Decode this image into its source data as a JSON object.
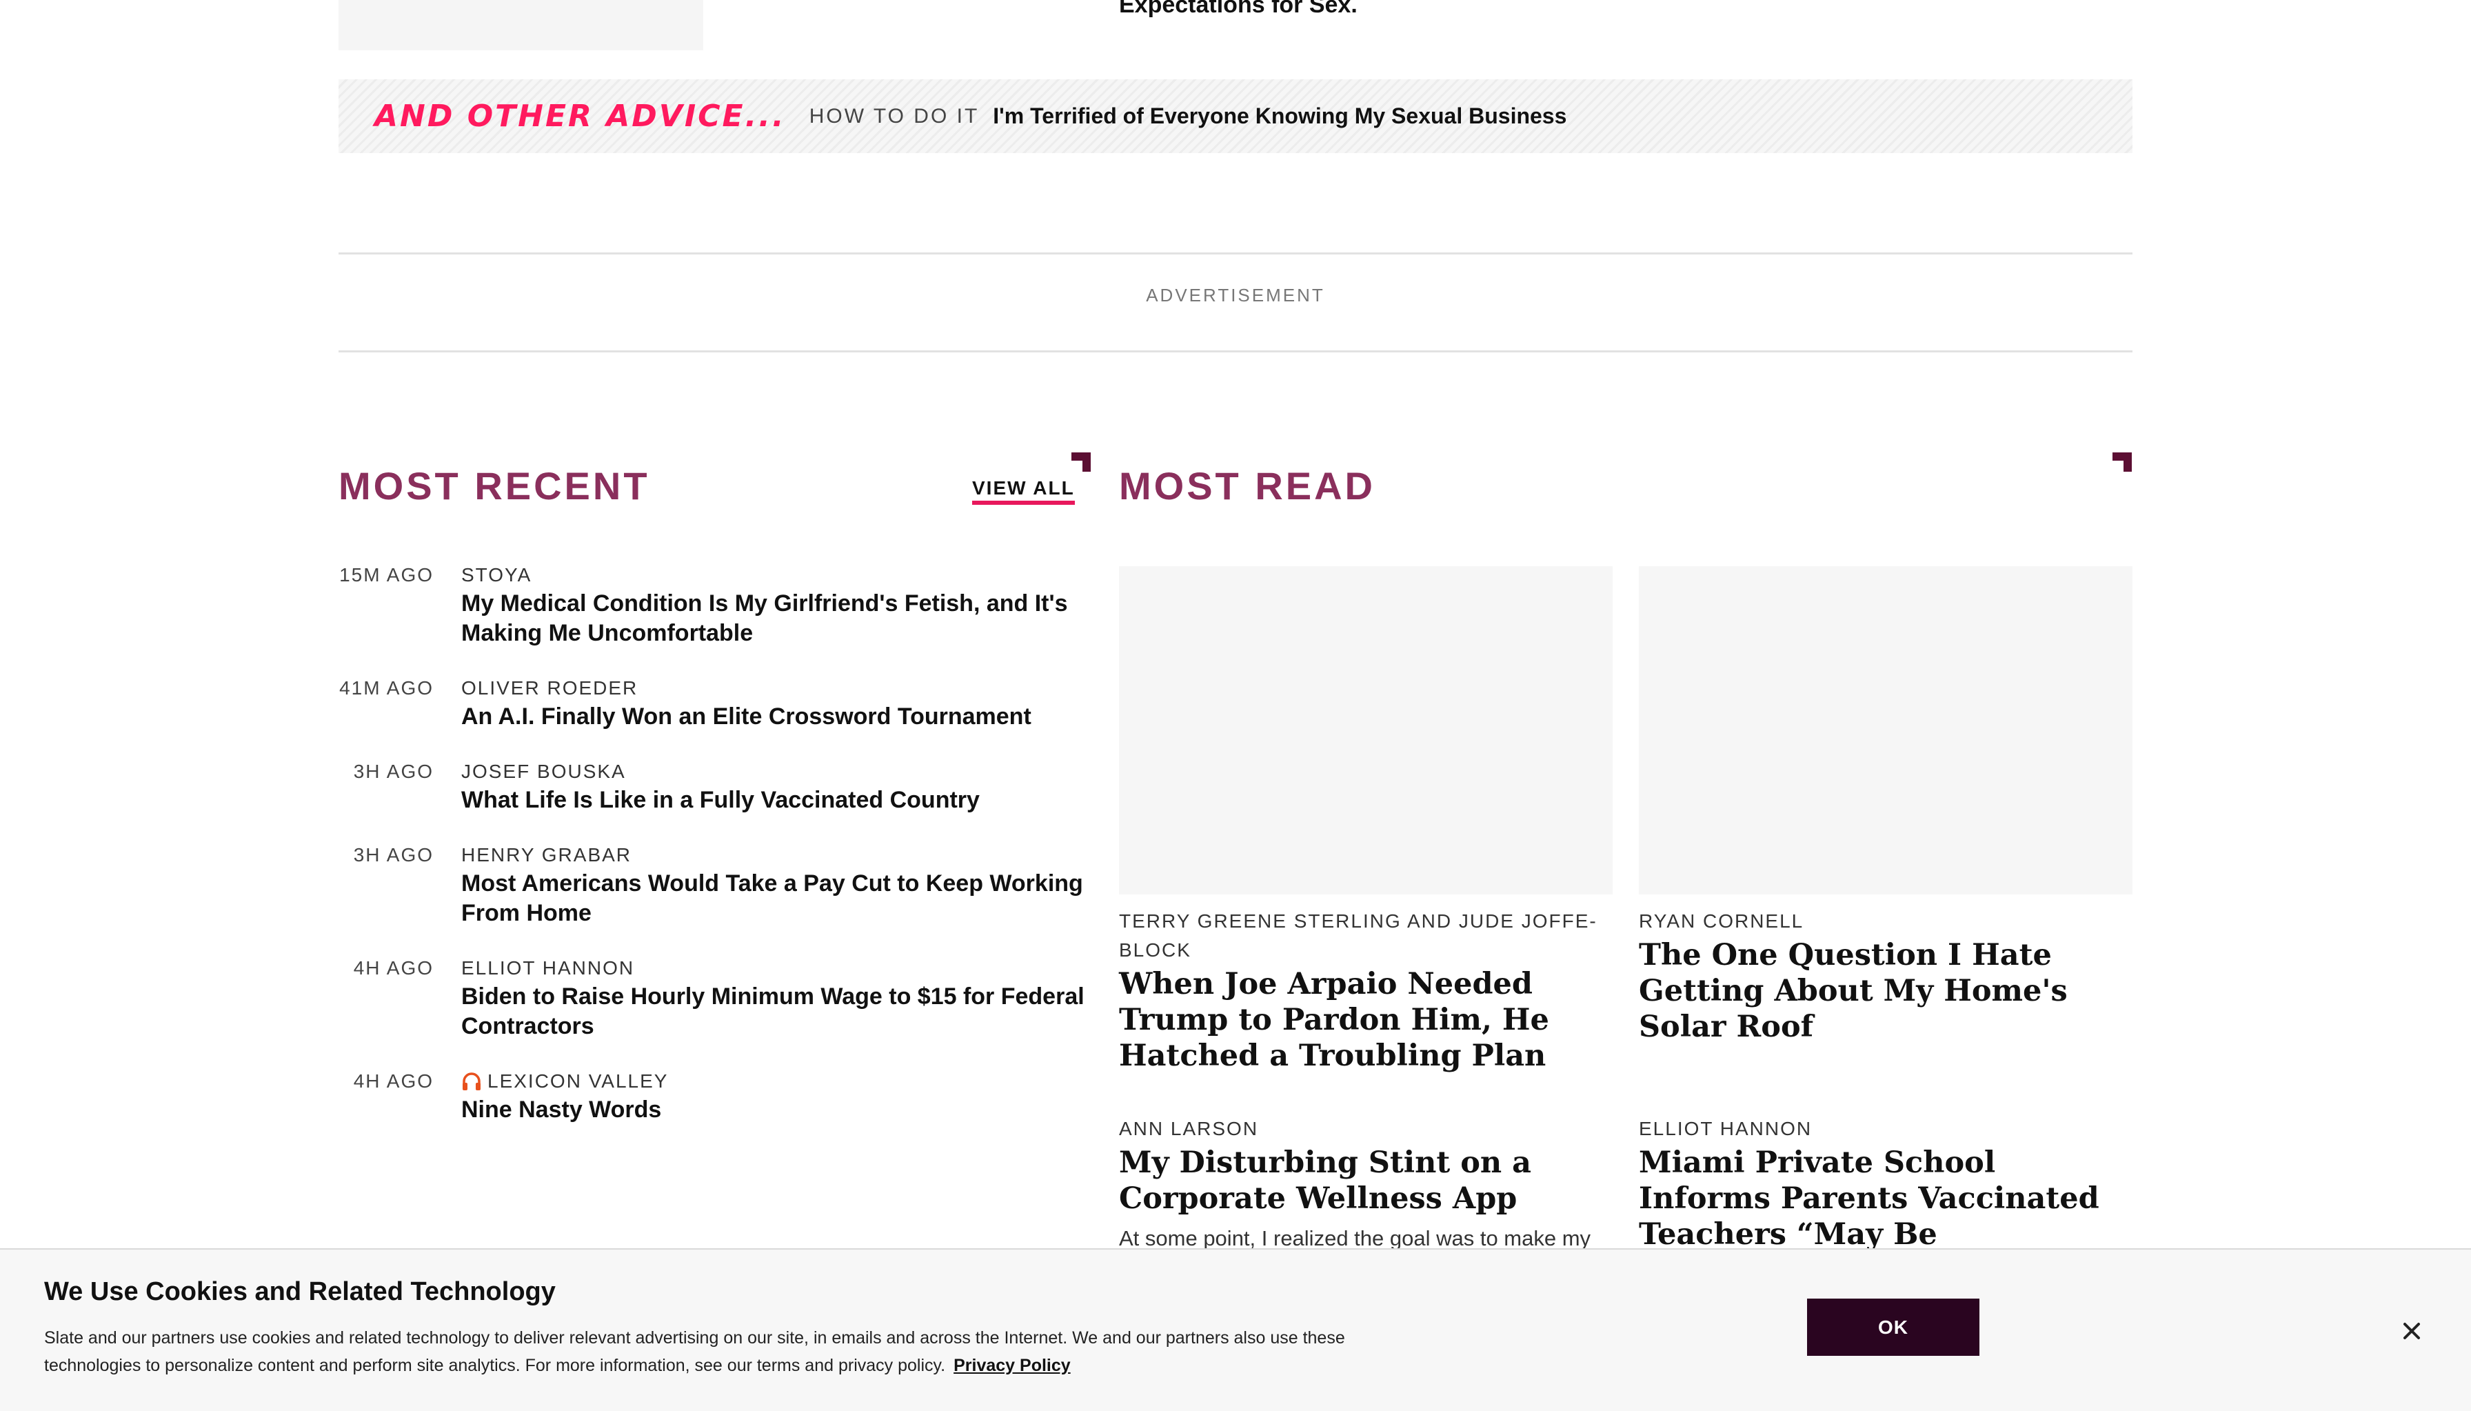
{
  "top": {
    "headline_fragment": "Expectations for Sex."
  },
  "advice_bar": {
    "brand": "AND OTHER ADVICE...",
    "kicker": "HOW TO DO IT",
    "title": "I'm Terrified of Everyone Knowing My Sexual Business"
  },
  "ad": {
    "label": "ADVERTISEMENT"
  },
  "most_recent": {
    "title": "MOST RECENT",
    "view_all": "VIEW ALL",
    "items": [
      {
        "time": "15M AGO",
        "author": "STOYA",
        "title": "My Medical Condition Is My Girlfriend's Fetish, and It's Making Me Uncomfortable"
      },
      {
        "time": "41M AGO",
        "author": "OLIVER ROEDER",
        "title": "An A.I. Finally Won an Elite Crossword Tournament"
      },
      {
        "time": "3H AGO",
        "author": "JOSEF BOUSKA",
        "title": "What Life Is Like in a Fully Vaccinated Country"
      },
      {
        "time": "3H AGO",
        "author": "HENRY GRABAR",
        "title": "Most Americans Would Take a Pay Cut to Keep Working From Home"
      },
      {
        "time": "4H AGO",
        "author": "ELLIOT HANNON",
        "title": "Biden to Raise Hourly Minimum Wage to $15 for Federal Contractors"
      },
      {
        "time": "4H AGO",
        "author": "LEXICON VALLEY",
        "title": "Nine Nasty Words",
        "icon": "headphones-icon"
      }
    ]
  },
  "most_read": {
    "title": "MOST READ",
    "items": [
      {
        "author": "TERRY GREENE STERLING AND JUDE JOFFE-BLOCK",
        "title": "When Joe Arpaio Needed Trump to Pardon Him, He Hatched a Troubling Plan"
      },
      {
        "author": "RYAN CORNELL",
        "title": "The One Question I Hate Getting About My Home's Solar Roof"
      },
      {
        "author": "ANN LARSON",
        "title": "My Disturbing Stint on a Corporate Wellness App",
        "dek": "At some point, I realized the goal was to make my"
      },
      {
        "author": "ELLIOT HANNON",
        "title": "Miami Private School Informs Parents Vaccinated Teachers “May Be Transmitting Something From"
      }
    ]
  },
  "cookie": {
    "title": "We Use Cookies and Related Technology",
    "body": "Slate and our partners use cookies and related technology to deliver relevant advertising on our site, in emails and across the Internet. We and our partners also use these technologies to personalize content and perform site analytics. For more information, see our terms and privacy policy.",
    "link": "Privacy Policy",
    "ok": "OK"
  },
  "colors": {
    "accent": "#8a2f5c",
    "advice_pink": "#ff1a5e",
    "underline": "#e8185c",
    "button": "#2a0520"
  }
}
